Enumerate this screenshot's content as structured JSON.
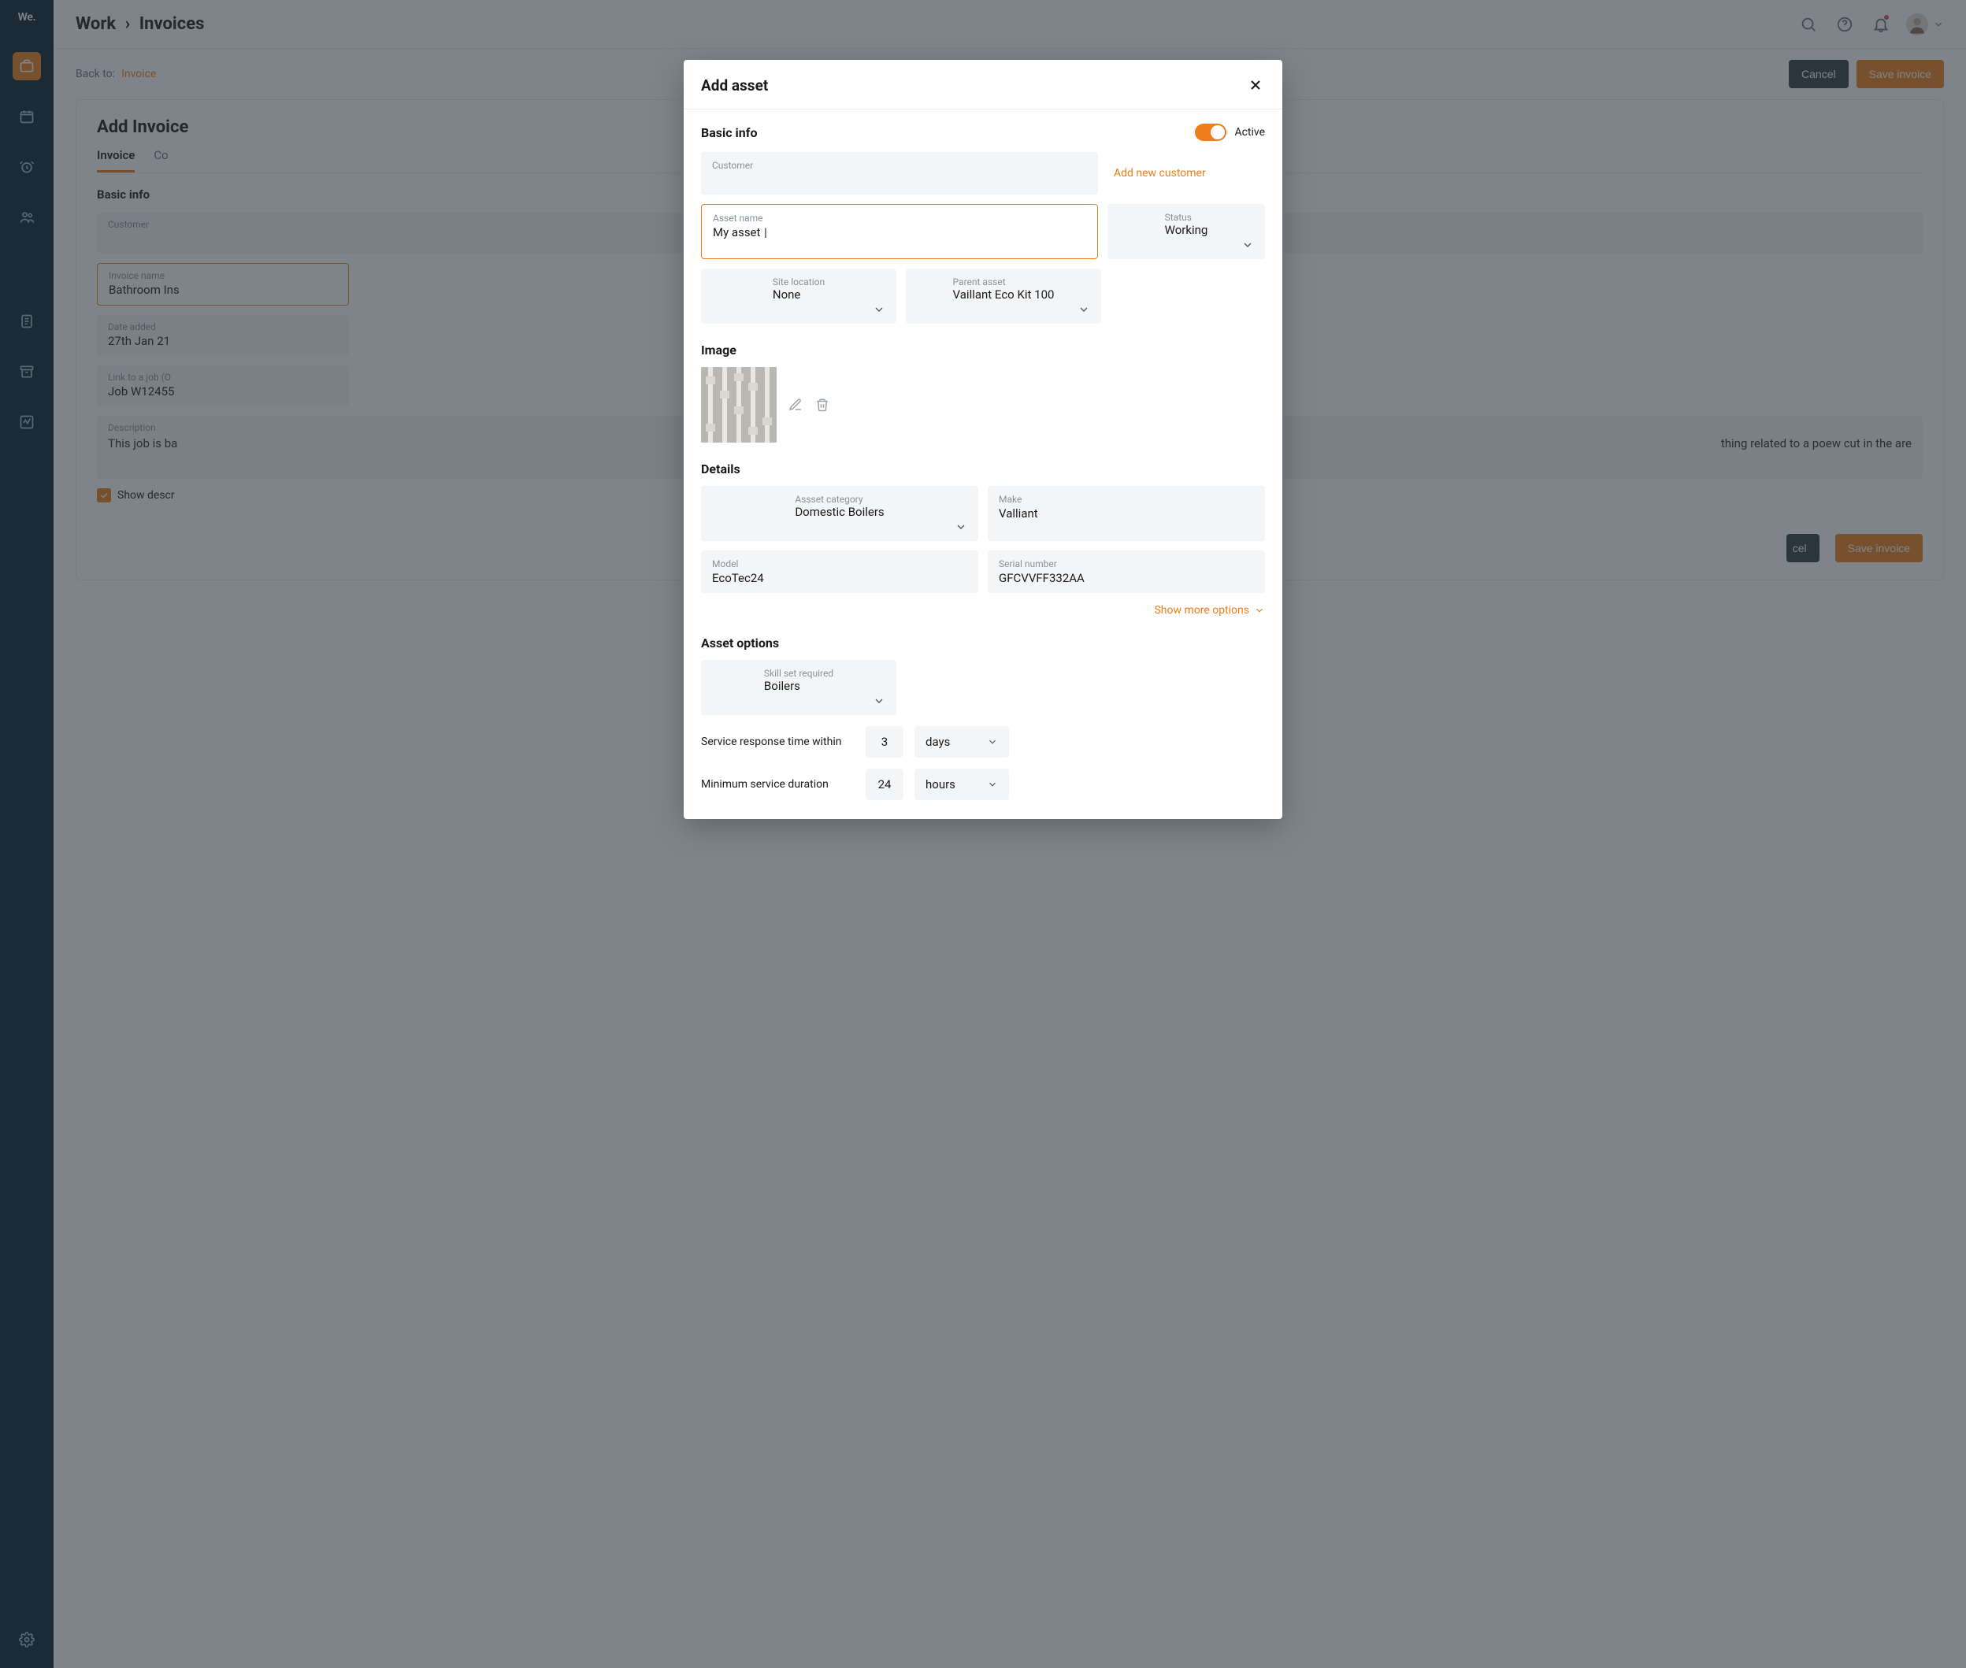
{
  "brand": "We.",
  "header": {
    "breadcrumb": [
      "Work",
      "Invoices"
    ]
  },
  "back": {
    "label": "Back to:",
    "link": "Invoice"
  },
  "actions": {
    "cancel": "Cancel",
    "save": "Save invoice"
  },
  "page": {
    "title": "Add Invoice",
    "tabs": [
      "Invoice",
      "Co"
    ],
    "basic_info_title": "Basic info",
    "fields": {
      "customer_label": "Customer",
      "invoice_name_label": "Invoice name",
      "invoice_name_value": "Bathroom Ins",
      "date_added_label": "Date added",
      "date_added_value": "27th Jan 21",
      "link_job_label": "Link to a job (O",
      "link_job_value": "Job W12455",
      "description_label": "Description",
      "description_value": "This job is ba",
      "description_tail": "thing related to a poew cut in the are",
      "show_desc": "Show descr"
    }
  },
  "modal": {
    "title": "Add asset",
    "sections": {
      "basic": "Basic info",
      "image": "Image",
      "details": "Details",
      "options": "Asset options"
    },
    "toggle_label": "Active",
    "customer_label": "Customer",
    "add_customer": "Add new customer",
    "asset_name_label": "Asset name",
    "asset_name_value": "My asset ",
    "status_label": "Status",
    "status_value": "Working",
    "site_location_label": "Site location",
    "site_location_value": "None",
    "parent_asset_label": "Parent asset",
    "parent_asset_value": "Vaillant Eco Kit 100",
    "asset_category_label": "Assset category",
    "asset_category_value": "Domestic Boilers",
    "make_label": "Make",
    "make_value": "Valliant",
    "model_label": "Model",
    "model_value": "EcoTec24",
    "serial_label": "Serial number",
    "serial_value": "GFCVVFF332AA",
    "show_more": "Show more options",
    "skill_label": "Skill set required",
    "skill_value": "Boilers",
    "response_label": "Service response time within",
    "response_value": "3",
    "response_unit": "days",
    "min_duration_label": "Minimum service duration",
    "min_duration_value": "24",
    "min_duration_unit": "hours"
  }
}
